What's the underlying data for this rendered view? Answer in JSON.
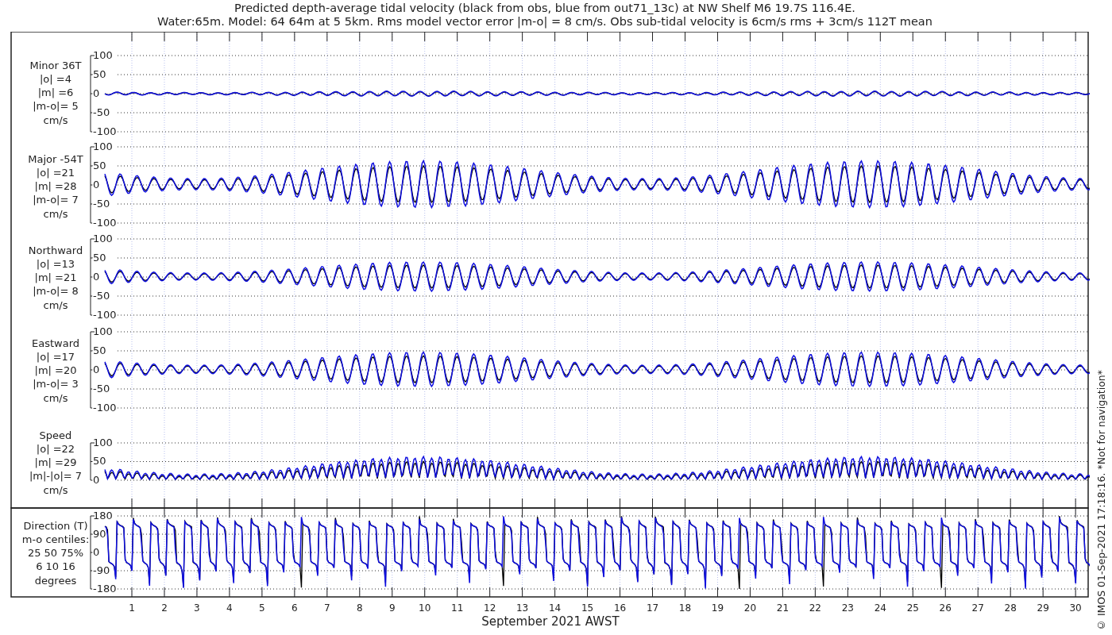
{
  "title_lines": [
    "Predicted depth-average tidal velocity (black from obs, blue from out71_13c) at NW Shelf M6 19.7S 116.4E.",
    "Water:65m. Model: 64 64m at 5 5km. Rms model vector error |m-o| = 8 cm/s. Obs sub-tidal velocity is 6cm/s rms + 3cm/s 112T mean"
  ],
  "panels": [
    {
      "kind": "minor",
      "label_lines": [
        "Minor 36T",
        "|o| =4",
        "|m| =6",
        "|m-o|= 5",
        "cm/s"
      ],
      "yticks": [
        "100",
        "50",
        "0",
        "-50",
        "-100"
      ]
    },
    {
      "kind": "major",
      "label_lines": [
        "Major -54T",
        "|o| =21",
        "|m| =28",
        "|m-o|= 7",
        "cm/s"
      ],
      "yticks": [
        "100",
        "50",
        "0",
        "-50",
        "-100"
      ]
    },
    {
      "kind": "northward",
      "label_lines": [
        "Northward",
        "|o| =13",
        "|m| =21",
        "|m-o|= 8",
        "cm/s"
      ],
      "yticks": [
        "100",
        "50",
        "0",
        "-50",
        "-100"
      ]
    },
    {
      "kind": "eastward",
      "label_lines": [
        "Eastward",
        "|o| =17",
        "|m| =20",
        "|m-o|= 3",
        "cm/s"
      ],
      "yticks": [
        "100",
        "50",
        "0",
        "-50",
        "-100"
      ]
    },
    {
      "kind": "speed",
      "label_lines": [
        "Speed",
        "|o| =22",
        "|m| =29",
        "|m|-|o|= 7",
        "cm/s"
      ],
      "yticks": [
        "100",
        "50",
        "0"
      ]
    },
    {
      "kind": "direction",
      "label_lines": [
        "Direction (T)",
        "m-o centiles:",
        "25 50 75%",
        "6 10 16",
        "degrees"
      ],
      "yticks": [
        "180",
        "90",
        "0",
        "-90",
        "-180"
      ]
    }
  ],
  "x_tick_labels": [
    "1",
    "2",
    "3",
    "4",
    "5",
    "6",
    "7",
    "8",
    "9",
    "10",
    "11",
    "12",
    "13",
    "14",
    "15",
    "16",
    "17",
    "18",
    "19",
    "20",
    "21",
    "22",
    "23",
    "24",
    "25",
    "26",
    "27",
    "28",
    "29",
    "30"
  ],
  "xlabel": "September 2021 AWST",
  "credit": "© IMOS 01-Sep-2021 17:18:16. *Not for navigation*"
}
